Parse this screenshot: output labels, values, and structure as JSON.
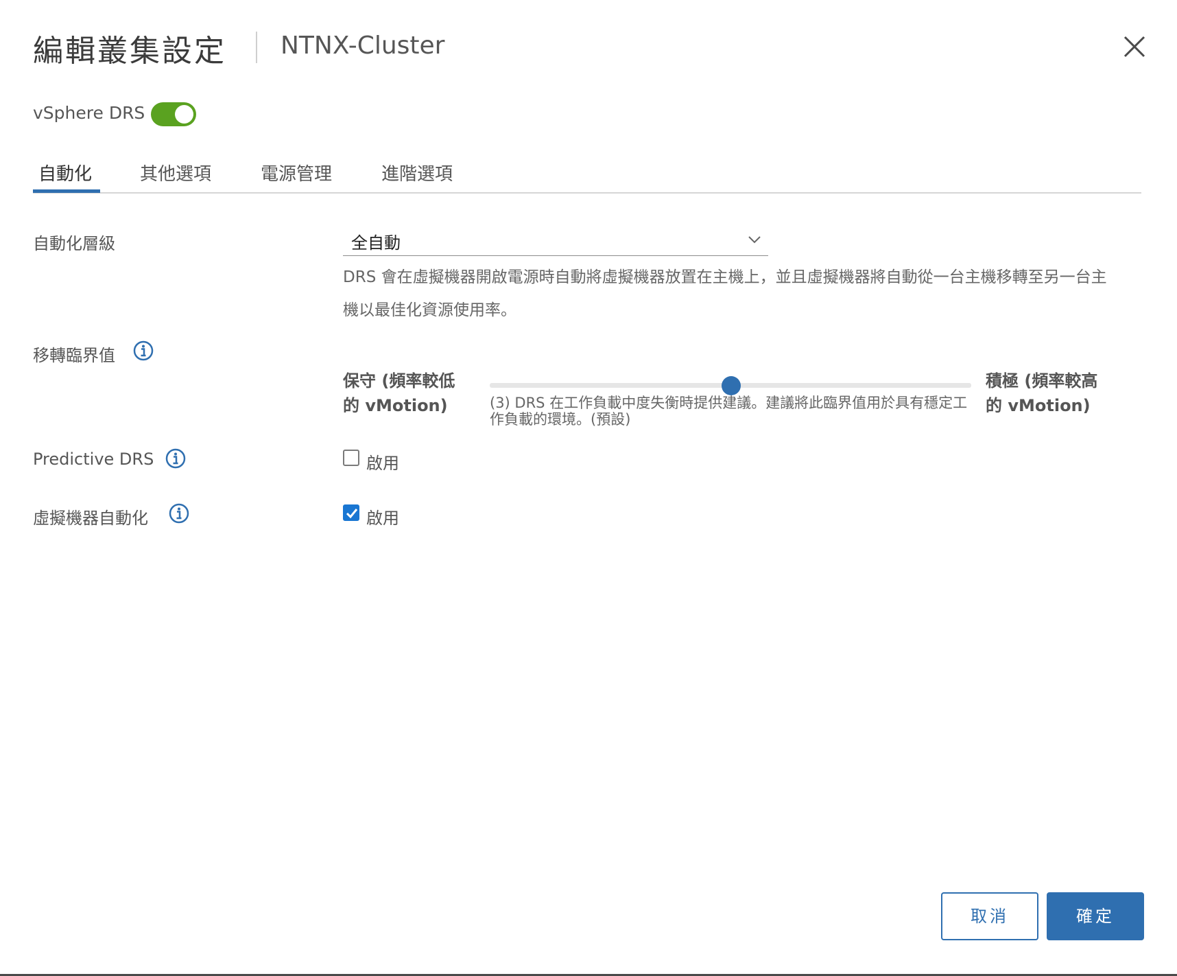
{
  "header": {
    "title": "編輯叢集設定",
    "subtitle": "NTNX-Cluster",
    "close_icon": "close-icon"
  },
  "drs_toggle": {
    "label": "vSphere DRS",
    "on": true,
    "color": "#5aa220"
  },
  "tabs": [
    {
      "label": "自動化",
      "active": true
    },
    {
      "label": "其他選項",
      "active": false
    },
    {
      "label": "電源管理",
      "active": false
    },
    {
      "label": "進階選項",
      "active": false
    }
  ],
  "automation_level": {
    "label": "自動化層級",
    "value": "全自動",
    "description": "DRS 會在虛擬機器開啟電源時自動將虛擬機器放置在主機上，並且虛擬機器將自動從一台主機移轉至另一台主機以最佳化資源使用率。"
  },
  "migration_threshold": {
    "label": "移轉臨界值",
    "left_label": "保守 (頻率較低的 vMotion)",
    "right_label": "積極 (頻率較高的 vMotion)",
    "level": 3,
    "max_level": 5,
    "description": "(3) DRS 在工作負載中度失衡時提供建議。建議將此臨界值用於具有穩定工作負載的環境。(預設)"
  },
  "predictive_drs": {
    "label": "Predictive DRS",
    "checkbox_label": "啟用",
    "checked": false
  },
  "vm_automation": {
    "label": "虛擬機器自動化",
    "checkbox_label": "啟用",
    "checked": true
  },
  "buttons": {
    "cancel": "取消",
    "ok": "確定"
  },
  "accent_color": "#2f6fb0"
}
